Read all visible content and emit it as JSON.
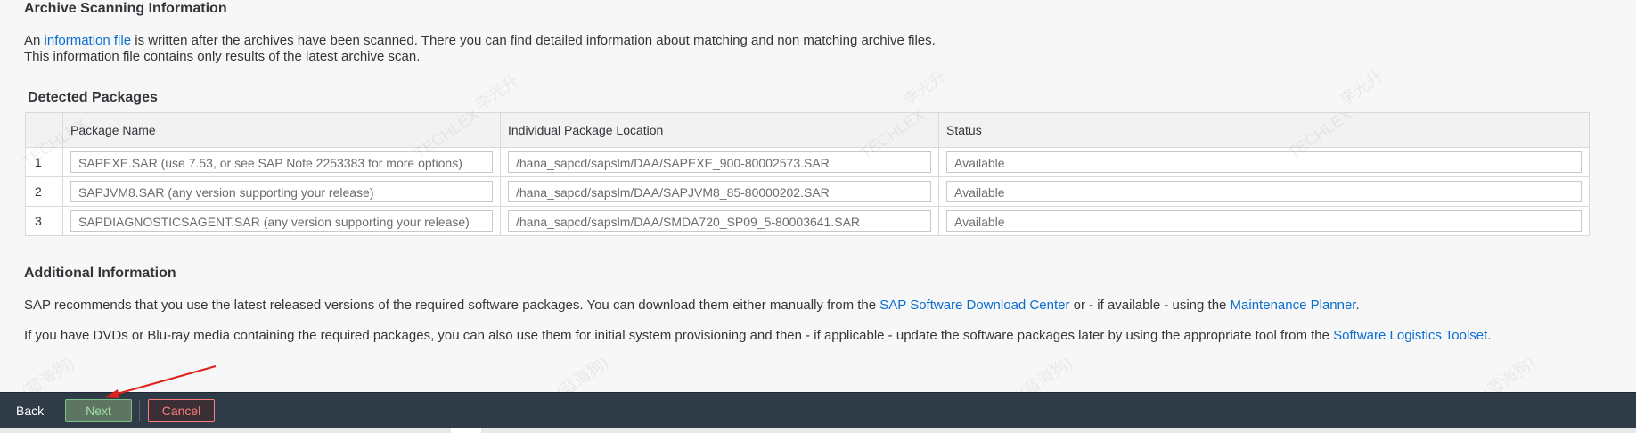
{
  "archive": {
    "title": "Archive Scanning Information",
    "line1_prefix": "An ",
    "line1_link": "information file",
    "line1_suffix": " is written after the archives have been scanned. There you can find detailed information about matching and non matching archive files.",
    "line2": "This information file contains only results of the latest archive scan."
  },
  "packages": {
    "title": "Detected Packages",
    "columns": [
      "",
      "Package Name",
      "Individual Package Location",
      "Status"
    ],
    "rows": [
      {
        "num": "1",
        "name": "SAPEXE.SAR (use 7.53, or see SAP Note 2253383 for more options)",
        "location": "/hana_sapcd/sapslm/DAA/SAPEXE_900-80002573.SAR",
        "status": "Available"
      },
      {
        "num": "2",
        "name": "SAPJVM8.SAR (any version supporting your release)",
        "location": "/hana_sapcd/sapslm/DAA/SAPJVM8_85-80000202.SAR",
        "status": "Available"
      },
      {
        "num": "3",
        "name": "SAPDIAGNOSTICSAGENT.SAR (any version supporting your release)",
        "location": "/hana_sapcd/sapslm/DAA/SMDA720_SP09_5-80003641.SAR",
        "status": "Available"
      }
    ]
  },
  "additional": {
    "title": "Additional Information",
    "p1_a": "SAP recommends that you use the latest released versions of the required software packages. You can download them either manually from the ",
    "p1_link1": "SAP Software Download Center",
    "p1_b": " or - if available - using the ",
    "p1_link2": "Maintenance Planner",
    "p1_c": ".",
    "p2_a": "If you have DVDs or Blu-ray media containing the required packages, you can also use them for initial system provisioning and then - if applicable - update the software packages later by using the appropriate tool from the ",
    "p2_link": "Software Logistics Toolset",
    "p2_b": "."
  },
  "footer": {
    "back_label": "Back",
    "next_label": "Next",
    "cancel_label": "Cancel"
  },
  "colors": {
    "footer_bg": "#2f3b46",
    "link": "#0a6ed1",
    "annotation_arrow": "#e0201b"
  },
  "watermark_text": [
    "TECHLEX",
    "李光升",
    "(蓝海狗)"
  ]
}
